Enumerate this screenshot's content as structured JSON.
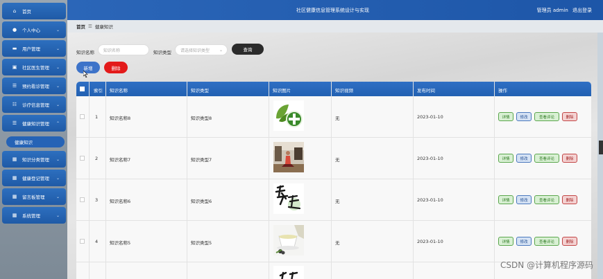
{
  "app": {
    "title": "社区健康信息管理系统设计与实现",
    "user_label": "管理员 admin",
    "logout_label": "退出登录"
  },
  "breadcrumb": {
    "home": "首页",
    "separator": "☰",
    "current": "健康知识"
  },
  "sidebar": {
    "items": [
      {
        "label": "首页",
        "icon": "home-icon"
      },
      {
        "label": "个人中心",
        "icon": "user-icon"
      },
      {
        "label": "用户管理",
        "icon": "monitor-icon"
      },
      {
        "label": "社区医生管理",
        "icon": "doctor-icon"
      },
      {
        "label": "预约看诊管理",
        "icon": "list-icon"
      },
      {
        "label": "诊疗信息管理",
        "icon": "sliders-icon"
      },
      {
        "label": "健康知识管理",
        "icon": "list-icon"
      },
      {
        "label": "知识分类管理",
        "icon": "grid-icon"
      },
      {
        "label": "健康登记管理",
        "icon": "grid-icon"
      },
      {
        "label": "留言板管理",
        "icon": "grid-icon"
      },
      {
        "label": "系统管理",
        "icon": "grid-icon"
      }
    ],
    "active_sub": "健康知识"
  },
  "search": {
    "name_label": "知识名称",
    "name_placeholder": "知识名称",
    "type_label": "知识类型",
    "type_placeholder": "请选择知识类型",
    "query_button": "查询"
  },
  "toolbar": {
    "add_label": "新增",
    "delete_label": "删除"
  },
  "table": {
    "headers": [
      "索引",
      "知识名称",
      "知识类型",
      "知识图片",
      "知识视频",
      "发布时间",
      "操作"
    ],
    "actions": [
      "详情",
      "修改",
      "查看评论",
      "删除"
    ],
    "rows": [
      {
        "index": "1",
        "name": "知识名称8",
        "type": "知识类型8",
        "video": "无",
        "date": "2023-01-10",
        "image": "leaf-plus"
      },
      {
        "index": "2",
        "name": "知识名称7",
        "type": "知识类型7",
        "video": "无",
        "date": "2023-01-10",
        "image": "yoga-room"
      },
      {
        "index": "3",
        "name": "知识名称6",
        "type": "知识类型6",
        "video": "无",
        "date": "2023-01-10",
        "image": "calligraphy"
      },
      {
        "index": "4",
        "name": "知识名称5",
        "type": "知识类型5",
        "video": "无",
        "date": "2023-01-10",
        "image": "tea-cup"
      }
    ]
  },
  "watermark": "CSDN @计算机程序源码"
}
